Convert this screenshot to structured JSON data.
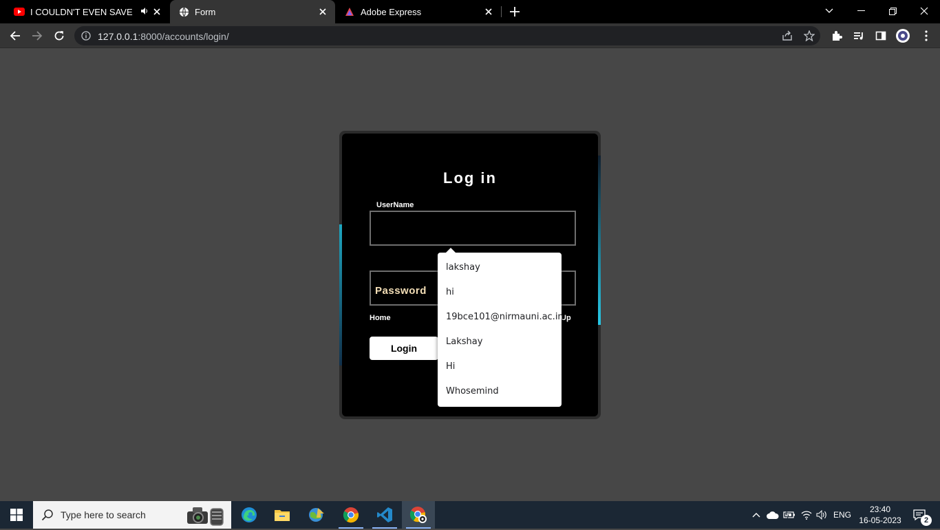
{
  "browser": {
    "tabs": [
      {
        "title": "I COULDN'T EVEN SAVE YOU",
        "icon": "youtube-icon"
      },
      {
        "title": "Form",
        "icon": "globe-icon"
      },
      {
        "title": "Adobe Express",
        "icon": "adobe-express-icon"
      }
    ],
    "url": {
      "host": "127.0.0.1",
      "rest": ":8000/accounts/login/"
    }
  },
  "form": {
    "heading": "Log in",
    "username_label": "UserName",
    "password_placeholder": "Password",
    "home_link": "Home",
    "signup_link": "Up",
    "login_button": "Login"
  },
  "autofill": {
    "suggestions": [
      "lakshay",
      "hi",
      "19bce101@nirmauni.ac.in",
      "Lakshay",
      "Hi",
      "Whosemind"
    ]
  },
  "taskbar": {
    "search_placeholder": "Type here to search",
    "language": "ENG",
    "time": "23:40",
    "date": "16-05-2023",
    "notification_count": "2"
  },
  "colors": {
    "page_bg": "#474747",
    "card_bg": "#000000",
    "accent_glow": "#27c8e6",
    "password_text": "#f3deb6"
  }
}
